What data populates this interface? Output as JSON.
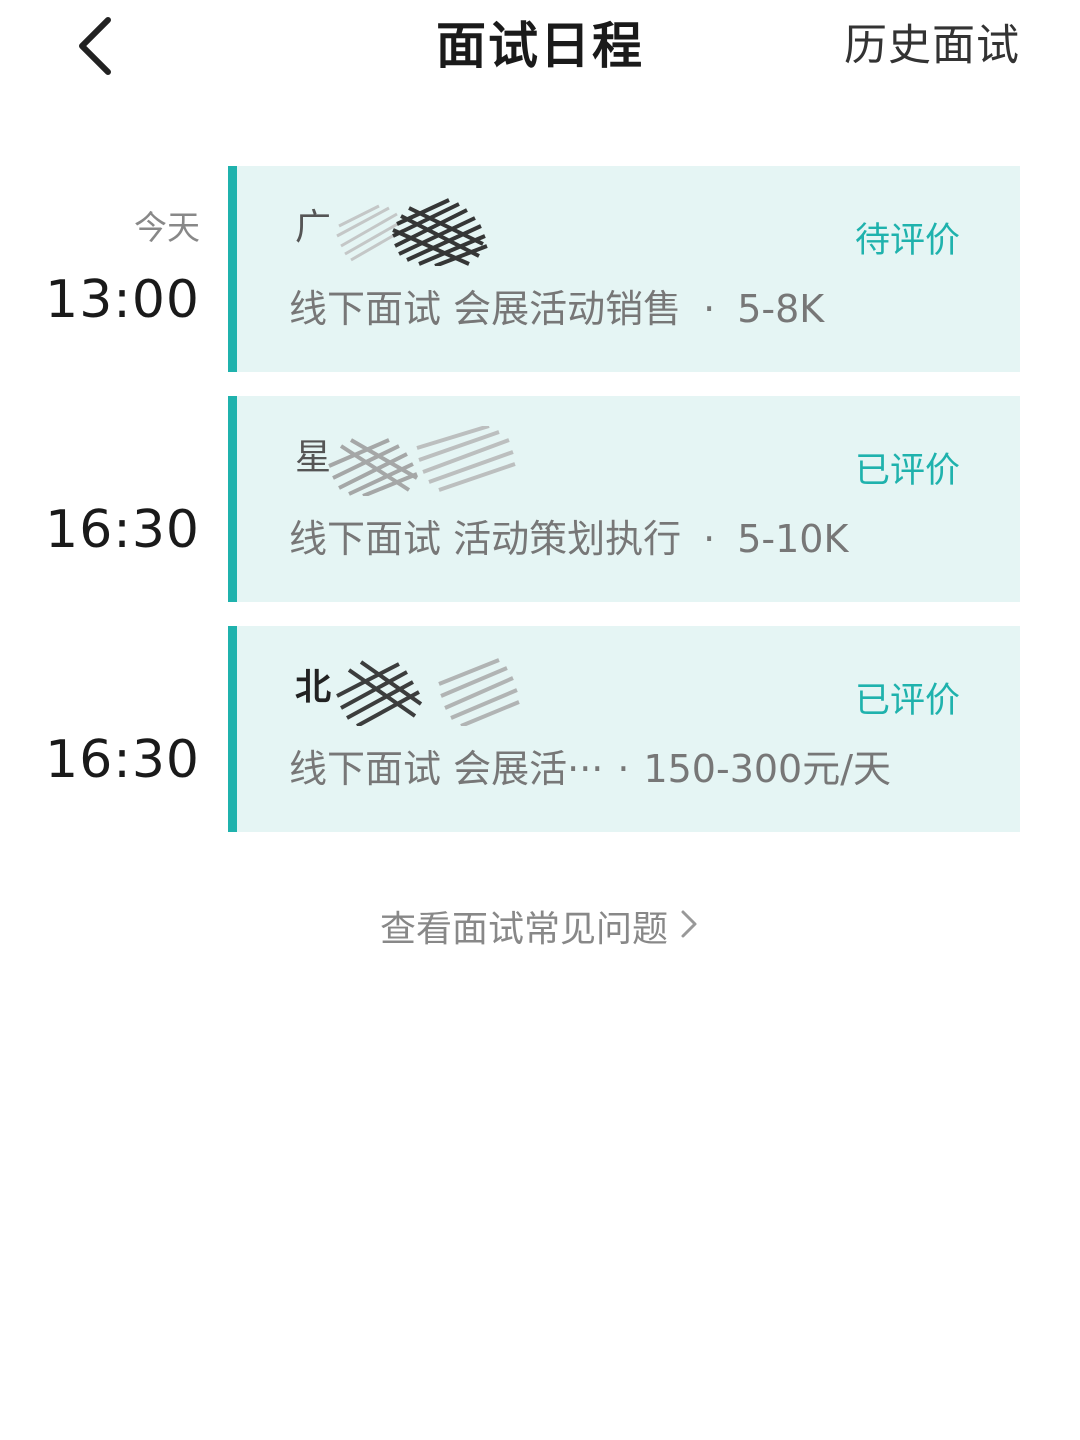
{
  "header": {
    "title": "面试日程",
    "history_label": "历史面试",
    "back_icon": "chevron-left-icon"
  },
  "interviews": [
    {
      "day": "今天",
      "time": "13:00",
      "company": "广",
      "status": "待评价",
      "type": "线下面试",
      "position": "会展活动销售",
      "separator": "·",
      "salary": "5-8K"
    },
    {
      "day": "",
      "time": "16:30",
      "company": "星",
      "status": "已评价",
      "type": "线下面试",
      "position": "活动策划执行",
      "separator": "·",
      "salary": "5-10K"
    },
    {
      "day": "",
      "time": "16:30",
      "company": "北",
      "status": "已评价",
      "type": "线下面试",
      "position": "会展活···",
      "separator": "·",
      "salary": "150-300元/天"
    }
  ],
  "footer": {
    "faq_label": "查看面试常见问题",
    "faq_icon": "chevron-right-icon"
  },
  "colors": {
    "accent": "#1fb2ad",
    "card_background": "#e5f5f4"
  }
}
